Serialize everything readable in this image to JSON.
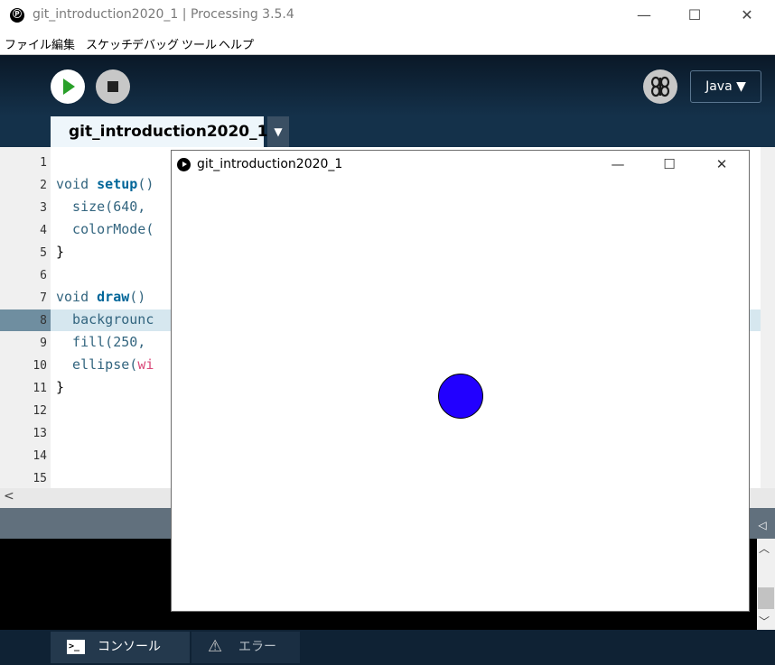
{
  "window": {
    "title": "git_introduction2020_1 | Processing 3.5.4",
    "app_icon": "Ⓟ",
    "minimize": "—",
    "maximize": "☐",
    "close": "✕"
  },
  "menu": [
    "ファイル",
    "編集",
    "スケッチ",
    "デバッグ",
    "ツール",
    "ヘルプ"
  ],
  "toolbar": {
    "run_icon": "play-icon",
    "stop_icon": "stop-icon",
    "debug_icon": "butterfly-icon",
    "mode_label": "Java ▼"
  },
  "tabs": [
    {
      "label": "git_introduction2020_1"
    }
  ],
  "tab_menu": "▼",
  "editor": {
    "line_numbers": [
      "1",
      "2",
      "3",
      "4",
      "5",
      "6",
      "7",
      "8",
      "9",
      "10",
      "11",
      "12",
      "13",
      "14",
      "15"
    ],
    "current_line": 8,
    "lines": [
      "",
      "void setup()",
      "  size(640,",
      "  colorMode(",
      "}",
      "",
      "void draw()",
      "  backgrounc",
      "  fill(250,",
      "  ellipse(wi",
      "}",
      "",
      "",
      "",
      ""
    ]
  },
  "scroll": {
    "left_arrow": "<",
    "right_arrow": "◁",
    "up_arrow": "︿",
    "down_arrow": "﹀"
  },
  "sketch_window": {
    "title": "git_introduction2020_1",
    "minimize": "—",
    "maximize": "☐",
    "close": "✕",
    "ball_color": "#2200ff"
  },
  "bottom": {
    "console_label": "コンソール",
    "console_icon": ">_",
    "error_label": "エラー",
    "error_icon": "⚠"
  },
  "colors": {
    "accent_bg": "#14314a",
    "run_green": "#2aa02a"
  }
}
